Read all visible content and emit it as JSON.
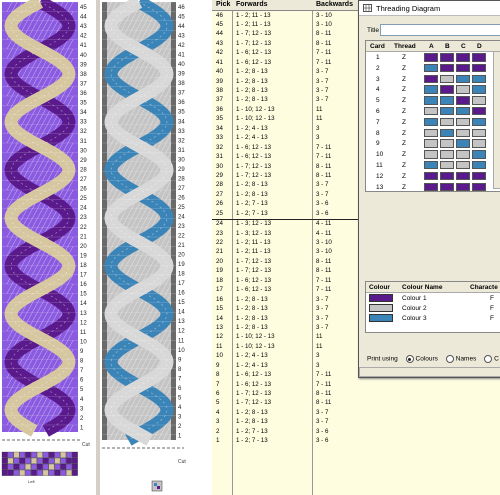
{
  "colors": {
    "purple": "#5a1a8c",
    "violet": "#8a5ae0",
    "tan": "#d6c7a0",
    "blue": "#3b84b8",
    "grey": "#c4c4c4",
    "table_bg": "#fffde0",
    "dialog_bg": "#ece9d8"
  },
  "draft": {
    "left_pick_numbers": [
      "45",
      "44",
      "43",
      "42",
      "41",
      "40",
      "39",
      "38",
      "37",
      "36",
      "35",
      "34",
      "33",
      "32",
      "31",
      "30",
      "29",
      "28",
      "27",
      "26",
      "25",
      "24",
      "23",
      "22",
      "21",
      "20",
      "19",
      "18",
      "17",
      "16",
      "15",
      "14",
      "13",
      "12",
      "11",
      "10",
      "9",
      "8",
      "7",
      "6",
      "5",
      "4",
      "3",
      "2",
      "1"
    ],
    "mid_pick_numbers": [
      "46",
      "45",
      "44",
      "43",
      "42",
      "41",
      "40",
      "39",
      "38",
      "37",
      "36",
      "35",
      "34",
      "33",
      "32",
      "31",
      "30",
      "29",
      "28",
      "27",
      "26",
      "25",
      "24",
      "23",
      "22",
      "21",
      "20",
      "19",
      "18",
      "17",
      "16",
      "15",
      "14",
      "13",
      "12",
      "11",
      "10",
      "9",
      "8",
      "7",
      "6",
      "5",
      "4",
      "3",
      "2",
      "1"
    ],
    "cut_label": "Cut",
    "threading_cut_label": "Cut",
    "left_caption": "Left",
    "mid_caption": "Cut"
  },
  "pick_table": {
    "headers": {
      "pick": "Pick",
      "forwards": "Forwards",
      "backwards": "Backwards"
    },
    "rows": [
      {
        "pick": "46",
        "fwd": "1 - 2; 11 - 13",
        "bwd": "3 - 10"
      },
      {
        "pick": "45",
        "fwd": "1 - 2; 11 - 13",
        "bwd": "3 - 10"
      },
      {
        "pick": "44",
        "fwd": "1 - 7; 12 - 13",
        "bwd": "8 - 11"
      },
      {
        "pick": "43",
        "fwd": "1 - 7; 12 - 13",
        "bwd": "8 - 11"
      },
      {
        "pick": "42",
        "fwd": "1 - 6; 12 - 13",
        "bwd": "7 - 11"
      },
      {
        "pick": "41",
        "fwd": "1 - 6; 12 - 13",
        "bwd": "7 - 11"
      },
      {
        "pick": "40",
        "fwd": "1 - 2; 8 - 13",
        "bwd": "3 - 7"
      },
      {
        "pick": "39",
        "fwd": "1 - 2; 8 - 13",
        "bwd": "3 - 7"
      },
      {
        "pick": "38",
        "fwd": "1 - 2; 8 - 13",
        "bwd": "3 - 7"
      },
      {
        "pick": "37",
        "fwd": "1 - 2; 8 - 13",
        "bwd": "3 - 7"
      },
      {
        "pick": "36",
        "fwd": "1 - 10; 12 - 13",
        "bwd": "11"
      },
      {
        "pick": "35",
        "fwd": "1 - 10; 12 - 13",
        "bwd": "11"
      },
      {
        "pick": "34",
        "fwd": "1 - 2; 4 - 13",
        "bwd": "3"
      },
      {
        "pick": "33",
        "fwd": "1 - 2; 4 - 13",
        "bwd": "3"
      },
      {
        "pick": "32",
        "fwd": "1 - 6; 12 - 13",
        "bwd": "7 - 11"
      },
      {
        "pick": "31",
        "fwd": "1 - 6; 12 - 13",
        "bwd": "7 - 11"
      },
      {
        "pick": "30",
        "fwd": "1 - 7; 12 - 13",
        "bwd": "8 - 11"
      },
      {
        "pick": "29",
        "fwd": "1 - 7; 12 - 13",
        "bwd": "8 - 11"
      },
      {
        "pick": "28",
        "fwd": "1 - 2; 8 - 13",
        "bwd": "3 - 7"
      },
      {
        "pick": "27",
        "fwd": "1 - 2; 8 - 13",
        "bwd": "3 - 7"
      },
      {
        "pick": "26",
        "fwd": "1 - 2; 7 - 13",
        "bwd": "3 - 6"
      },
      {
        "pick": "25",
        "fwd": "1 - 2; 7 - 13",
        "bwd": "3 - 6"
      },
      {
        "pick": "24",
        "fwd": "1 - 3; 12 - 13",
        "bwd": "4 - 11"
      },
      {
        "pick": "23",
        "fwd": "1 - 3; 12 - 13",
        "bwd": "4 - 11"
      },
      {
        "pick": "22",
        "fwd": "1 - 2; 11 - 13",
        "bwd": "3 - 10"
      },
      {
        "pick": "21",
        "fwd": "1 - 2; 11 - 13",
        "bwd": "3 - 10"
      },
      {
        "pick": "20",
        "fwd": "1 - 7; 12 - 13",
        "bwd": "8 - 11"
      },
      {
        "pick": "19",
        "fwd": "1 - 7; 12 - 13",
        "bwd": "8 - 11"
      },
      {
        "pick": "18",
        "fwd": "1 - 6; 12 - 13",
        "bwd": "7 - 11"
      },
      {
        "pick": "17",
        "fwd": "1 - 6; 12 - 13",
        "bwd": "7 - 11"
      },
      {
        "pick": "16",
        "fwd": "1 - 2; 8 - 13",
        "bwd": "3 - 7"
      },
      {
        "pick": "15",
        "fwd": "1 - 2; 8 - 13",
        "bwd": "3 - 7"
      },
      {
        "pick": "14",
        "fwd": "1 - 2; 8 - 13",
        "bwd": "3 - 7"
      },
      {
        "pick": "13",
        "fwd": "1 - 2; 8 - 13",
        "bwd": "3 - 7"
      },
      {
        "pick": "12",
        "fwd": "1 - 10; 12 - 13",
        "bwd": "11"
      },
      {
        "pick": "11",
        "fwd": "1 - 10; 12 - 13",
        "bwd": "11"
      },
      {
        "pick": "10",
        "fwd": "1 - 2; 4 - 13",
        "bwd": "3"
      },
      {
        "pick": "9",
        "fwd": "1 - 2; 4 - 13",
        "bwd": "3"
      },
      {
        "pick": "8",
        "fwd": "1 - 6; 12 - 13",
        "bwd": "7 - 11"
      },
      {
        "pick": "7",
        "fwd": "1 - 6; 12 - 13",
        "bwd": "7 - 11"
      },
      {
        "pick": "6",
        "fwd": "1 - 7; 12 - 13",
        "bwd": "8 - 11"
      },
      {
        "pick": "5",
        "fwd": "1 - 7; 12 - 13",
        "bwd": "8 - 11"
      },
      {
        "pick": "4",
        "fwd": "1 - 2; 8 - 13",
        "bwd": "3 - 7"
      },
      {
        "pick": "3",
        "fwd": "1 - 2; 8 - 13",
        "bwd": "3 - 7"
      },
      {
        "pick": "2",
        "fwd": "1 - 2; 7 - 13",
        "bwd": "3 - 6"
      },
      {
        "pick": "1",
        "fwd": "1 - 2; 7 - 13",
        "bwd": "3 - 6"
      }
    ]
  },
  "dialog": {
    "window_title": "Threading Diagram",
    "title_label": "Title",
    "title_value": "",
    "card_headers": [
      "Card",
      "Thread",
      "A",
      "B",
      "C",
      "D"
    ],
    "cards": [
      {
        "card": "1",
        "thread": "Z",
        "holes": [
          "purple",
          "purple",
          "purple",
          "purple"
        ]
      },
      {
        "card": "2",
        "thread": "Z",
        "holes": [
          "blue",
          "purple",
          "purple",
          "purple"
        ]
      },
      {
        "card": "3",
        "thread": "Z",
        "holes": [
          "purple",
          "grey",
          "blue",
          "blue"
        ]
      },
      {
        "card": "4",
        "thread": "Z",
        "holes": [
          "blue",
          "purple",
          "grey",
          "blue"
        ]
      },
      {
        "card": "5",
        "thread": "Z",
        "holes": [
          "blue",
          "blue",
          "purple",
          "grey"
        ]
      },
      {
        "card": "6",
        "thread": "Z",
        "holes": [
          "grey",
          "blue",
          "blue",
          "purple"
        ]
      },
      {
        "card": "7",
        "thread": "Z",
        "holes": [
          "blue",
          "grey",
          "grey",
          "blue"
        ]
      },
      {
        "card": "8",
        "thread": "Z",
        "holes": [
          "grey",
          "blue",
          "grey",
          "grey"
        ]
      },
      {
        "card": "9",
        "thread": "Z",
        "holes": [
          "grey",
          "grey",
          "blue",
          "grey"
        ]
      },
      {
        "card": "10",
        "thread": "Z",
        "holes": [
          "grey",
          "grey",
          "grey",
          "blue"
        ]
      },
      {
        "card": "11",
        "thread": "Z",
        "holes": [
          "blue",
          "grey",
          "grey",
          "blue"
        ]
      },
      {
        "card": "12",
        "thread": "Z",
        "holes": [
          "purple",
          "purple",
          "purple",
          "purple"
        ]
      },
      {
        "card": "13",
        "thread": "Z",
        "holes": [
          "purple",
          "purple",
          "purple",
          "purple"
        ]
      }
    ],
    "colour_headers": [
      "Colour",
      "Colour Name",
      "Characte"
    ],
    "colours": [
      {
        "swatch": "purple",
        "name": "Colour 1",
        "char": "F"
      },
      {
        "swatch": "grey",
        "name": "Colour 2",
        "char": "F"
      },
      {
        "swatch": "blue",
        "name": "Colour 3",
        "char": "F"
      }
    ],
    "print_label": "Print using",
    "opt_colours": "Colours",
    "opt_names": "Names",
    "opt_third": "C"
  }
}
